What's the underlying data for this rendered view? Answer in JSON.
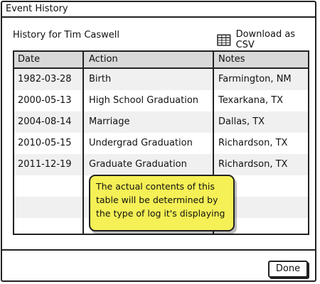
{
  "window": {
    "title": "Event History"
  },
  "header": {
    "history_for": "History for Tim Caswell",
    "download_label": "Download as CSV",
    "download_icon": "table-icon"
  },
  "table": {
    "columns": [
      "Date",
      "Action",
      "Notes"
    ],
    "rows": [
      [
        "1982-03-28",
        "Birth",
        "Farmington, NM"
      ],
      [
        "2000-05-13",
        "High School Graduation",
        "Texarkana, TX"
      ],
      [
        "2004-08-14",
        "Marriage",
        "Dallas, TX"
      ],
      [
        "2010-05-15",
        "Undergrad Graduation",
        "Richardson, TX"
      ],
      [
        "2011-12-19",
        "Graduate Graduation",
        "Richardson, TX"
      ]
    ]
  },
  "sticky_note": {
    "text": "The actual contents of this table will be determined by the type of log it's displaying",
    "color": "#f5f055"
  },
  "footer": {
    "done_label": "Done"
  }
}
